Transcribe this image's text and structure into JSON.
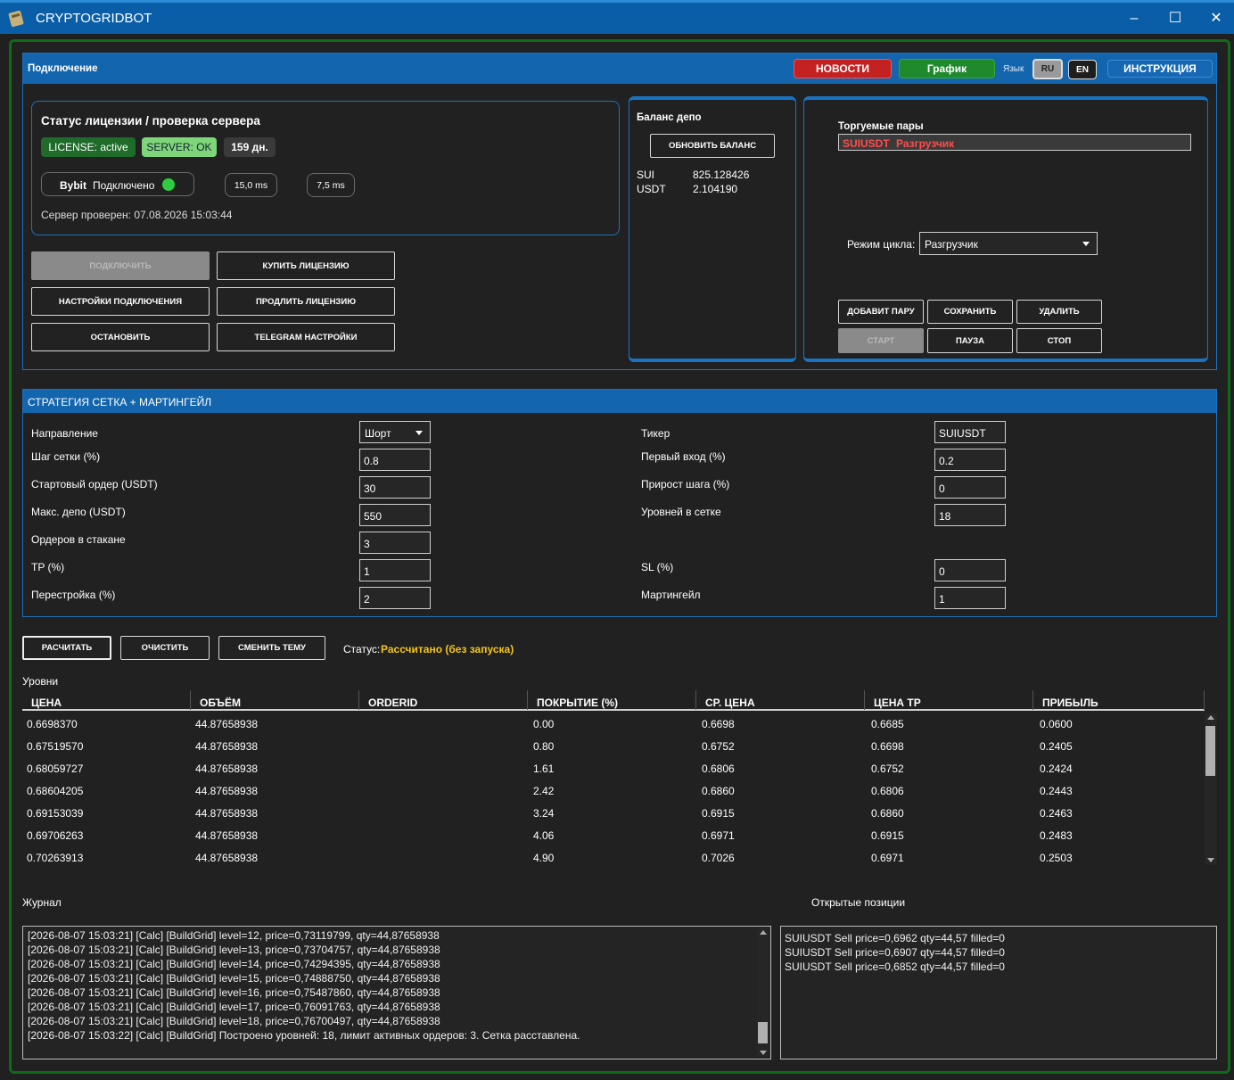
{
  "window": {
    "title": "CRYPTOGRIDBOT",
    "minimize": "–",
    "maximize": "☐",
    "close": "✕"
  },
  "connection": {
    "title": "Подключение",
    "news": "НОВОСТИ",
    "chart": "График",
    "lang_label": "Язык",
    "lang_ru": "RU",
    "lang_en": "EN",
    "instructions": "ИНСТРУКЦИЯ"
  },
  "license": {
    "title": "Статус лицензии / проверка сервера",
    "license_badge": "LICENSE: active",
    "server_badge": "SERVER: OK",
    "days_badge": "159 дн.",
    "exchange": "Bybit",
    "exchange_status": "Подключено",
    "ping1": "15,0 ms",
    "ping2": "7,5 ms",
    "checked": "Сервер проверен: 07.08.2026 15:03:44",
    "status_color": "#2ecc40"
  },
  "buttons": {
    "connect": "ПОДКЛЮЧИТЬ",
    "buy_license": "КУПИТЬ ЛИЦЕНЗИЮ",
    "conn_settings": "НАСТРОЙКИ ПОДКЛЮЧЕНИЯ",
    "extend_license": "ПРОДЛИТЬ ЛИЦЕНЗИЮ",
    "stop": "ОСТАНОВИТЬ",
    "telegram": "TELEGRAM НАСТРОЙКИ"
  },
  "balance": {
    "title": "Баланс депо",
    "refresh": "ОБНОВИТЬ БАЛАНС",
    "rows": [
      {
        "asset": "SUI",
        "amount": "825.128426"
      },
      {
        "asset": "USDT",
        "amount": "2.104190"
      }
    ]
  },
  "pairs": {
    "title": "Торгуемые пары",
    "selected_pair": "SUIUSDT",
    "selected_mode": "Разгрузчик",
    "cycle_label": "Режим цикла:",
    "cycle_value": "Разгрузчик",
    "add": "ДОБАВИТ ПАРУ",
    "save": "СОХРАНИТЬ",
    "delete": "УДАЛИТЬ",
    "start": "СТАРТ",
    "pause": "ПАУЗА",
    "stop": "СТОП"
  },
  "strategy": {
    "title": "СТРАТЕГИЯ СЕТКА + МАРТИНГЕЙЛ",
    "direction_label": "Направление",
    "direction_value": "Шорт",
    "grid_step_label": "Шаг сетки (%)",
    "grid_step_value": "0.8",
    "start_order_label": "Стартовый ордер (USDT)",
    "start_order_value": "30",
    "max_depo_label": "Макс. депо (USDT)",
    "max_depo_value": "550",
    "orders_book_label": "Ордеров в стакане",
    "orders_book_value": "3",
    "tp_label": "TP (%)",
    "tp_value": "1",
    "rebuild_label": "Перестройка (%)",
    "rebuild_value": "2",
    "ticker_label": "Тикер",
    "ticker_value": "SUIUSDT",
    "first_entry_label": "Первый вход (%)",
    "first_entry_value": "0.2",
    "step_growth_label": "Прирост шага (%)",
    "step_growth_value": "0",
    "levels_label": "Уровней в сетке",
    "levels_value": "18",
    "sl_label": "SL (%)",
    "sl_value": "0",
    "martingale_label": "Мартингейл",
    "martingale_value": "1"
  },
  "actions": {
    "calc": "РАСЧИТАТЬ",
    "clear": "ОЧИСТИТЬ",
    "theme": "СМЕНИТЬ ТЕМУ",
    "status_label": "Статус:",
    "status_value": "Рассчитано (без запуска)",
    "status_color": "#f5c518"
  },
  "levels": {
    "title": "Уровни",
    "columns": [
      "ЦЕНА",
      "ОБЪЁМ",
      "ORDERID",
      "ПОКРЫТИЕ (%)",
      "СР. ЦЕНА",
      "ЦЕНА ТР",
      "ПРИБЫЛЬ"
    ],
    "rows": [
      [
        "0.6698370",
        "44.87658938",
        "",
        "0.00",
        "0.6698",
        "0.6685",
        "0.0600"
      ],
      [
        "0.67519570",
        "44.87658938",
        "",
        "0.80",
        "0.6752",
        "0.6698",
        "0.2405"
      ],
      [
        "0.68059727",
        "44.87658938",
        "",
        "1.61",
        "0.6806",
        "0.6752",
        "0.2424"
      ],
      [
        "0.68604205",
        "44.87658938",
        "",
        "2.42",
        "0.6860",
        "0.6806",
        "0.2443"
      ],
      [
        "0.69153039",
        "44.87658938",
        "",
        "3.24",
        "0.6915",
        "0.6860",
        "0.2463"
      ],
      [
        "0.69706263",
        "44.87658938",
        "",
        "4.06",
        "0.6971",
        "0.6915",
        "0.2483"
      ],
      [
        "0.70263913",
        "44.87658938",
        "",
        "4.90",
        "0.7026",
        "0.6971",
        "0.2503"
      ]
    ]
  },
  "journal": {
    "title": "Журнал",
    "lines": [
      "[2026-08-07 15:03:21] [Calc] [BuildGrid] level=12, price=0,73119799, qty=44,87658938",
      "[2026-08-07 15:03:21] [Calc] [BuildGrid] level=13, price=0,73704757, qty=44,87658938",
      "[2026-08-07 15:03:21] [Calc] [BuildGrid] level=14, price=0,74294395, qty=44,87658938",
      "[2026-08-07 15:03:21] [Calc] [BuildGrid] level=15, price=0,74888750, qty=44,87658938",
      "[2026-08-07 15:03:21] [Calc] [BuildGrid] level=16, price=0,75487860, qty=44,87658938",
      "[2026-08-07 15:03:21] [Calc] [BuildGrid] level=17, price=0,76091763, qty=44,87658938",
      "[2026-08-07 15:03:21] [Calc] [BuildGrid] level=18, price=0,76700497, qty=44,87658938",
      "[2026-08-07 15:03:22] [Calc] [BuildGrid] Построено уровней: 18, лимит активных ордеров: 3. Сетка расставлена."
    ]
  },
  "positions": {
    "title": "Открытые позиции",
    "lines": [
      "SUIUSDT Sell price=0,6962 qty=44,57 filled=0",
      "SUIUSDT Sell price=0,6907 qty=44,57 filled=0",
      "SUIUSDT Sell price=0,6852 qty=44,57 filled=0"
    ]
  }
}
